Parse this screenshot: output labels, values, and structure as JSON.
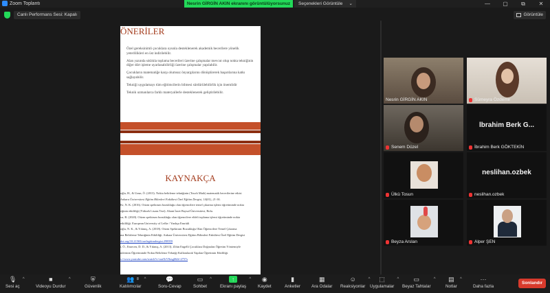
{
  "window": {
    "title": "Zoom Toplantı",
    "controls": [
      "—",
      "▢",
      "⧉",
      "✕"
    ]
  },
  "share_banner": "Nesrin GİRGİN AKIN ekranını görüntülüyorsunuz",
  "view_options": "Seçenekleri Görüntüle",
  "infobar": {
    "performance": "Canlı Performans Sesi: Kapalı",
    "view_label": "Görüntüle"
  },
  "slide": {
    "title1": "ÖNERİLER",
    "bullets": [
      "Özel gereksinimli çocuklara oyunla desteklenerek akademik becerilere yönelik yeterlilikleri en üst indirilebilir.",
      "Alan yazında sıklıkla toplama becerileri üzerine çalışmalar mevcut olup nokta tekniğinin diğer dört işleme uyarlanabilirliği üzerine çalışmalar yapılabilir.",
      "Çocukların matematiğe karşı olumsuz önyargılarını dönüştürerek başarılarına katkı sağlayabilir.",
      "Tekniği uygulamayı tüm eğitimcilerin bilmesi sürdürülebilirlik için önemlidir",
      "Teknik uzmanlarca farklı materyallerle desteklenerek geliştirilebilir."
    ],
    "title2": "KAYNAKÇA",
    "refs": [
      "oğlu, H., & Uzun, Ö. (2013). Nokta belirleme tekniğinin (Touch Math) matematik becerilerine etkisi",
      "Ankara Üniversitesi Eğitim Bilimleri Fakültesi Özel Eğitim Dergisi, 14(01), 21-36.",
      "Kr, N. K. (2016). Otizm spektrum bozukluğu olan öğrencilere temel çıkarma işlemi öğretiminde nokta",
      "eğinin etkililiği (Yüksek Lisans Tezi). Abant İzzet Baysal Üniversitesi, Bolu.",
      "sır, B. (2020). Otizm spektrum bozukluğu olan öğrencilere eldeli toplama işlemi öğretiminde nokta",
      "etkililiği. European University of Lefke / Yanlışa Emriüli",
      "oğlu, N. K., & Yıkmış, A. (2018). Otizm Spektrum Bozukluğu Olan Öğrencilere Temel Çıkarma",
      "ma Belirleme Tekniğinin Etkililiği. Ankara Üniversitesi Eğitim Bilimleri Fakültesi Özel Eğitim Dergisi",
      "doi.org/10.21565/ozelegitimdergisi.298959",
      "t, Ö., Emecen, D. D., & Yıkmış, A. (2013). Zihin Engelli Çocuklara Doğrudan Öğretim Yöntemiyle",
      "mlerinin Öğretiminde Nokta Belirleme Tekniği Kullanılarak Yapılan Öğretimin Etkililiği.",
      "s://www.youtube.com/watch?v=oatXtV8zsgI&lt=2757s"
    ]
  },
  "participants": [
    {
      "name": "Nesrin GİRGİN AKIN",
      "type": "video",
      "muted": false
    },
    {
      "name": "Sümeyra Özdemir",
      "type": "video",
      "muted": true
    },
    {
      "name": "Senem Düzel",
      "type": "video",
      "muted": true
    },
    {
      "name": "İbrahim Berk GÖKTEKİN",
      "display": "İbrahim Berk G...",
      "type": "name",
      "muted": true
    },
    {
      "name": "Ülkü Tosun",
      "type": "photo",
      "muted": true
    },
    {
      "name": "neslihan.ozbek",
      "display": "neslihan.ozbek",
      "type": "name",
      "muted": true
    },
    {
      "name": "Beyza Arslan",
      "type": "photo",
      "muted": true
    },
    {
      "name": "Alper ŞEN",
      "type": "photo",
      "muted": true
    }
  ],
  "toolbar": {
    "audio": "Sesi aç",
    "video": "Videoyu Durdur",
    "security": "Güvenlik",
    "participants": "Katılımcılar",
    "participants_count": "8",
    "qa": "Soru-Cevap",
    "chat": "Sohbet",
    "share": "Ekranı paylaş",
    "record": "Kaydet",
    "polls": "Anketler",
    "breakout": "Ara Odalar",
    "reactions": "Reaksiyonlar",
    "apps": "Uygulamalar",
    "whiteboards": "Beyaz Tahtalar",
    "notes": "Notlar",
    "more": "Daha fazla",
    "end": "Sonlandır"
  },
  "colors": {
    "accent_green": "#23d959",
    "end_red": "#d83a2c",
    "speaker_yellow": "#e8d43a",
    "slide_title": "#a33b1c"
  }
}
